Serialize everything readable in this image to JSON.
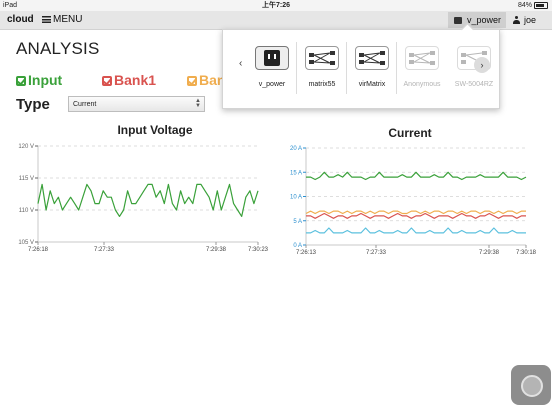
{
  "status_bar": {
    "device": "iPad",
    "time": "上午7:26",
    "battery": "84%"
  },
  "nav": {
    "brand": "cloud",
    "menu_label": "MENU",
    "device_name": "v_power",
    "user": "joe"
  },
  "page": {
    "title": "ANALYSIS"
  },
  "legend": [
    {
      "label": "Input",
      "color": "#3aa13a"
    },
    {
      "label": "Bank1",
      "color": "#d9534f"
    },
    {
      "label": "Ban",
      "color": "#f0ad4e"
    }
  ],
  "type_filter": {
    "label": "Type",
    "selected": "Current"
  },
  "popover": {
    "devices": [
      {
        "name": "v_power",
        "icon": "outlet-icon",
        "selected": true,
        "available": true
      },
      {
        "name": "matrix55",
        "icon": "matrix-icon",
        "selected": false,
        "available": true
      },
      {
        "name": "virMatrix",
        "icon": "matrix-icon",
        "selected": false,
        "available": true
      },
      {
        "name": "Anonymous",
        "icon": "matrix-icon",
        "selected": false,
        "available": false
      },
      {
        "name": "SW-5004RZ",
        "icon": "matrix-icon",
        "selected": false,
        "available": false
      }
    ]
  },
  "chart_data": [
    {
      "type": "line",
      "title": "Input Voltage",
      "ylim": [
        105,
        120
      ],
      "yticks": [
        "120 V",
        "115 V",
        "110 V",
        "105 V"
      ],
      "xtick_labels": [
        "7:26:18",
        "7:27:33",
        "7:29:38",
        "7:30:23"
      ],
      "grid": true,
      "series": [
        {
          "color": "#3aa13a",
          "values": [
            111,
            114,
            110,
            113,
            111,
            112,
            110,
            111,
            112,
            111,
            110,
            112,
            114,
            113,
            111,
            111,
            113,
            112,
            112,
            110,
            109,
            110,
            113,
            111,
            111,
            112,
            113,
            114,
            114,
            112,
            113,
            111,
            114,
            111,
            110,
            113,
            111,
            112,
            111,
            114,
            114,
            113,
            112,
            110,
            113,
            110,
            112,
            114,
            111,
            110,
            109,
            112,
            113,
            111,
            113
          ]
        }
      ]
    },
    {
      "type": "line",
      "title": "Current",
      "ylim": [
        0,
        20
      ],
      "yticks": [
        "20 A",
        "15 A",
        "10 A",
        "5 A",
        "0 A"
      ],
      "xtick_labels": [
        "7:26:13",
        "7:27:33",
        "7:29:38",
        "7:30:18"
      ],
      "grid": true,
      "series": [
        {
          "color": "#3aa13a",
          "values": [
            14,
            14,
            13.5,
            14,
            15,
            14,
            14,
            14.5,
            14,
            15,
            14,
            14,
            14,
            13.5,
            14,
            14,
            15,
            14,
            14,
            14,
            14,
            14.5,
            14,
            14,
            15,
            14,
            14,
            14,
            14.5,
            14,
            14,
            15,
            14,
            14,
            13.5,
            14,
            14,
            14,
            14.5,
            14,
            14,
            14,
            14,
            15,
            14,
            14,
            14,
            13.5,
            14
          ]
        },
        {
          "color": "#f0ad4e",
          "values": [
            6.5,
            7,
            6.5,
            7,
            7,
            6.5,
            7,
            7,
            6.5,
            7,
            6.5,
            7,
            7,
            6.5,
            7,
            6.5,
            7,
            7,
            6.5,
            7,
            7,
            6.5,
            6.5,
            7,
            7,
            6.5,
            7,
            6.5,
            7,
            7,
            6.5,
            7,
            7,
            6.5,
            7,
            6.5,
            7,
            7,
            6.5,
            7,
            7,
            6.5,
            7,
            6.5,
            7,
            7,
            6.5,
            7,
            7
          ]
        },
        {
          "color": "#d9534f",
          "values": [
            6,
            6,
            5.5,
            6,
            6.5,
            6,
            5.5,
            6,
            6,
            5.5,
            6,
            6,
            6.5,
            6,
            5.5,
            6,
            6,
            6,
            5.5,
            6,
            6.5,
            6,
            6,
            5.5,
            6,
            6,
            6.5,
            6,
            5.5,
            6,
            6,
            6,
            5.5,
            6,
            6.5,
            6,
            6,
            5.5,
            6,
            6,
            6.5,
            6,
            5.5,
            6,
            6,
            6,
            5.5,
            6,
            6
          ]
        },
        {
          "color": "#5bc0de",
          "values": [
            2.5,
            2.5,
            3,
            2.5,
            2.5,
            3.5,
            2.5,
            2.5,
            2.5,
            3,
            2.5,
            2.5,
            2.5,
            3.5,
            2.5,
            2.5,
            3,
            2.5,
            2.5,
            2.5,
            3,
            2.5,
            2.5,
            3.5,
            2.5,
            2.5,
            2.5,
            3,
            2.5,
            2.5,
            2.5,
            3.5,
            2.5,
            2.5,
            3,
            2.5,
            2.5,
            2.5,
            3,
            2.5,
            2.5,
            3.5,
            2.5,
            2.5,
            2.5,
            3,
            2.5,
            2.5,
            2.5
          ]
        }
      ]
    }
  ]
}
